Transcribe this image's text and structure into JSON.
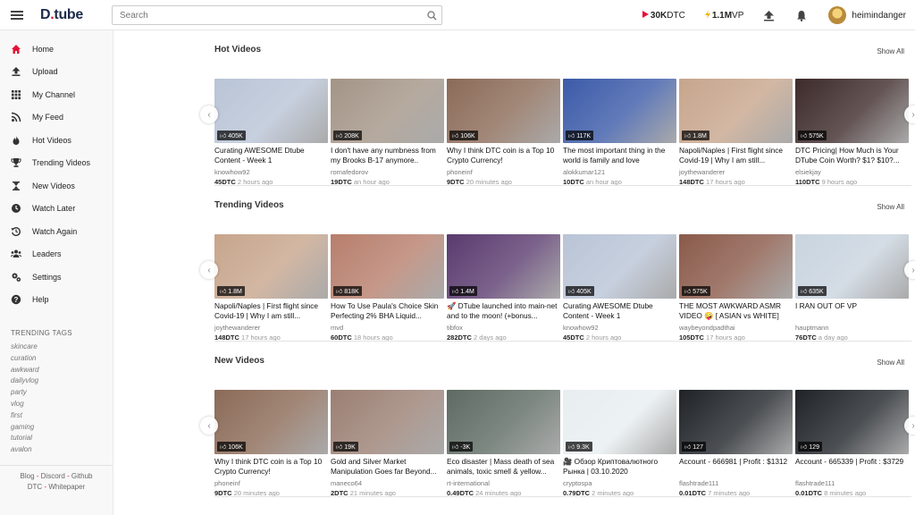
{
  "header": {
    "logo_main": "D",
    "logo_dot": ".",
    "logo_tail": "tube",
    "search_placeholder": "Search",
    "dtc_balance": "30K",
    "dtc_unit": "DTC",
    "vp_balance": "1.1M",
    "vp_unit": "VP",
    "username": "heimindanger",
    "brand_color": "#e31337"
  },
  "sidebar": {
    "items": [
      {
        "label": "Home",
        "icon": "home-icon"
      },
      {
        "label": "Upload",
        "icon": "upload-icon"
      },
      {
        "label": "My Channel",
        "icon": "grid-icon"
      },
      {
        "label": "My Feed",
        "icon": "feed-icon"
      },
      {
        "label": "Hot Videos",
        "icon": "flame-icon"
      },
      {
        "label": "Trending Videos",
        "icon": "trophy-icon"
      },
      {
        "label": "New Videos",
        "icon": "hourglass-icon"
      },
      {
        "label": "Watch Later",
        "icon": "clock-icon"
      },
      {
        "label": "Watch Again",
        "icon": "history-icon"
      },
      {
        "label": "Leaders",
        "icon": "users-icon"
      },
      {
        "label": "Settings",
        "icon": "gears-icon"
      },
      {
        "label": "Help",
        "icon": "question-icon"
      }
    ],
    "tags_title": "TRENDING TAGS",
    "tags": [
      "skincare",
      "curation",
      "awkward",
      "dailyvlog",
      "party",
      "vlog",
      "first",
      "gaming",
      "tutorial",
      "avalon"
    ],
    "footer": {
      "blog": "Blog",
      "discord": "Discord",
      "github": "Github",
      "dtc": "DTC",
      "whitepaper": "Whitepaper",
      "separator": "-"
    }
  },
  "sections": [
    {
      "title": "Hot Videos",
      "show_all": "Show All",
      "videos": [
        {
          "title": "Curating AWESOME Dtube Content - Week 1",
          "author": "knowhow92",
          "value": "45DTC",
          "age": "2 hours ago",
          "votes": "405K",
          "bg": "#b9c4d6"
        },
        {
          "title": "I don't have any numbness from my Brooks B-17 anymore..",
          "author": "romafedorov",
          "value": "19DTC",
          "age": "an hour ago",
          "votes": "208K",
          "bg": "#a39486"
        },
        {
          "title": "Why I think DTC coin is a Top 10 Crypto Currency!",
          "author": "phoneinf",
          "value": "9DTC",
          "age": "20 minutes ago",
          "votes": "106K",
          "bg": "#8b6a57"
        },
        {
          "title": "The most important thing in the world is family and love",
          "author": "alokkumar121",
          "value": "10DTC",
          "age": "an hour ago",
          "votes": "117K",
          "bg": "#3b5aa8"
        },
        {
          "title": "Napoli/Naples | First flight since Covid-19 | Why I am still...",
          "author": "joythewanderer",
          "value": "148DTC",
          "age": "17 hours ago",
          "votes": "1.8M",
          "bg": "#c7a58c"
        },
        {
          "title": "DTC Pricing| How Much is Your DTube Coin Worth? $1? $10?...",
          "author": "elsiekjay",
          "value": "110DTC",
          "age": "9 hours ago",
          "votes": "575K",
          "bg": "#3d2a2a"
        }
      ]
    },
    {
      "title": "Trending Videos",
      "show_all": "Show All",
      "videos": [
        {
          "title": "Napoli/Naples | First flight since Covid-19 | Why I am still...",
          "author": "joythewanderer",
          "value": "148DTC",
          "age": "17 hours ago",
          "votes": "1.8M",
          "bg": "#c7a58c"
        },
        {
          "title": "How To Use Paula's Choice Skin Perfecting 2% BHA Liquid...",
          "author": "mvd",
          "value": "60DTC",
          "age": "18 hours ago",
          "votes": "818K",
          "bg": "#b77e6c"
        },
        {
          "title": "🚀 DTube launched into main-net and to the moon! (+bonus...",
          "author": "tibfox",
          "value": "282DTC",
          "age": "2 days ago",
          "votes": "1.4M",
          "bg": "#5a3a6e"
        },
        {
          "title": "Curating AWESOME Dtube Content - Week 1",
          "author": "knowhow92",
          "value": "45DTC",
          "age": "2 hours ago",
          "votes": "405K",
          "bg": "#b9c4d6"
        },
        {
          "title": "THE MOST AWKWARD ASMR VIDEO 🤪 [ ASIAN vs WHITE]",
          "author": "waybeyondpadthai",
          "value": "105DTC",
          "age": "17 hours ago",
          "votes": "575K",
          "bg": "#8a5a4a"
        },
        {
          "title": "I RAN OUT OF VP",
          "author": "hauptmann",
          "value": "76DTC",
          "age": "a day ago",
          "votes": "635K",
          "bg": "#c9d4df"
        }
      ]
    },
    {
      "title": "New Videos",
      "show_all": "Show All",
      "videos": [
        {
          "title": "Why I think DTC coin is a Top 10 Crypto Currency!",
          "author": "phoneinf",
          "value": "9DTC",
          "age": "20 minutes ago",
          "votes": "106K",
          "bg": "#8b6a57"
        },
        {
          "title": "Gold and Silver Market Manipulation Goes far Beyond...",
          "author": "maneco64",
          "value": "2DTC",
          "age": "21 minutes ago",
          "votes": "19K",
          "bg": "#9a7f73"
        },
        {
          "title": "Eco disaster | Mass death of sea animals, toxic smell & yellow...",
          "author": "rt-international",
          "value": "0.49DTC",
          "age": "24 minutes ago",
          "votes": "-3K",
          "bg": "#5d6a62"
        },
        {
          "title": "🎥 Обзор Криптовалютного Рынка | 03.10.2020",
          "author": "cryptospa",
          "value": "0.79DTC",
          "age": "2 minutes ago",
          "votes": "9.3K",
          "bg": "#e8eef0"
        },
        {
          "title": "Account - 666981 | Profit : $1312",
          "author": "flashtrade111",
          "value": "0.01DTC",
          "age": "7 minutes ago",
          "votes": "127",
          "bg": "#1f2328"
        },
        {
          "title": "Account - 665339 | Profit : $3729",
          "author": "flashtrade111",
          "value": "0.01DTC",
          "age": "8 minutes ago",
          "votes": "129",
          "bg": "#1f2328"
        }
      ]
    }
  ]
}
